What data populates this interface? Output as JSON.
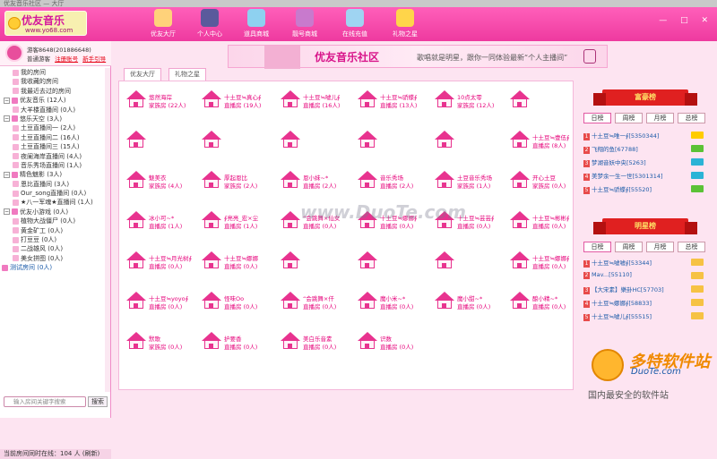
{
  "window": {
    "title": "优友音乐社区 — 大厅"
  },
  "logo": {
    "title": "优友音乐",
    "url": "www.yo68.com"
  },
  "nav": [
    {
      "label": "优友大厅",
      "icon": "house-icon"
    },
    {
      "label": "个人中心",
      "icon": "person-icon"
    },
    {
      "label": "道具商城",
      "icon": "shop-icon"
    },
    {
      "label": "靓号商城",
      "icon": "number-icon"
    },
    {
      "label": "在线充值",
      "icon": "coin-icon"
    },
    {
      "label": "礼物之星",
      "icon": "star-icon"
    }
  ],
  "user": {
    "name": "游客8648(201886648)",
    "role": "普通游客",
    "register": "注册账号",
    "newbie": "新手引导"
  },
  "tree": [
    {
      "type": "c",
      "label": "我的房间"
    },
    {
      "type": "c",
      "label": "我收藏的房间"
    },
    {
      "type": "c",
      "label": "我最近去过的房间"
    },
    {
      "type": "g",
      "label": "优友音乐  (12人)"
    },
    {
      "type": "c",
      "label": "大羊楼直播间  (0人)"
    },
    {
      "type": "g",
      "label": "悠乐天空  (3人)"
    },
    {
      "type": "c",
      "label": "土豆直播间一  (2人)"
    },
    {
      "type": "c",
      "label": "土豆直播间二  (16人)"
    },
    {
      "type": "c",
      "label": "土豆直播间三  (15人)"
    },
    {
      "type": "c",
      "label": "夜阑海岸直播间  (4人)"
    },
    {
      "type": "c",
      "label": "音乐秀场直播间  (1人)"
    },
    {
      "type": "g",
      "label": "精色魅影  (3人)"
    },
    {
      "type": "c",
      "label": "恩比直播间  (3人)"
    },
    {
      "type": "c",
      "label": "Our_song直播间  (0人)"
    },
    {
      "type": "c",
      "label": "★八一军魂★直播间  (1人)"
    },
    {
      "type": "g",
      "label": "优友小游戏  (0人)"
    },
    {
      "type": "c",
      "label": "植物大战僵尸  (0人)"
    },
    {
      "type": "c",
      "label": "黄金矿工  (0人)"
    },
    {
      "type": "c",
      "label": "打豆豆  (0人)"
    },
    {
      "type": "c",
      "label": "二战雄风  (0人)"
    },
    {
      "type": "c",
      "label": "美女拼图  (0人)"
    },
    {
      "type": "r",
      "label": "测试房间  (0人)"
    }
  ],
  "search": {
    "placeholder": "输入房间关键字搜索",
    "button": "搜索"
  },
  "status": {
    "text": "当前房间同时在线：104 人",
    "refresh": "(刷新)"
  },
  "banner": {
    "title": "优友音乐社区",
    "text": "歌唱就是明星，跟你一同体验最新“个人主播间”"
  },
  "tabs": [
    {
      "label": "优友大厅"
    },
    {
      "label": "礼物之星"
    }
  ],
  "rooms": [
    {
      "name": "悠然海岸",
      "count": "家族房 (22人)"
    },
    {
      "name": "十土豆≒真心∮",
      "count": "直播房 (19人)"
    },
    {
      "name": "十土豆≒嘘儿∮",
      "count": "直播房 (16人)"
    },
    {
      "name": "十土豆≒骄蝶∮",
      "count": "直播房 (13人)"
    },
    {
      "name": "10点太零",
      "count": "家族房 (12人)"
    },
    {
      "name": "",
      "count": ""
    },
    {
      "name": "",
      "count": ""
    },
    {
      "name": "",
      "count": ""
    },
    {
      "name": "",
      "count": ""
    },
    {
      "name": "",
      "count": ""
    },
    {
      "name": "",
      "count": ""
    },
    {
      "name": "十土豆≒壹伍∮",
      "count": "直播房 (8人)"
    },
    {
      "name": "魅美衣",
      "count": "家族房 (4人)"
    },
    {
      "name": "厚起恩比",
      "count": "家族房 (2人)"
    },
    {
      "name": "恩小妹~*",
      "count": "直播房 (2人)"
    },
    {
      "name": "音乐秀场",
      "count": "直播房 (2人)"
    },
    {
      "name": "土豆音乐秀场",
      "count": "家族房 (1人)"
    },
    {
      "name": "开心土豆",
      "count": "家族房 (0人)"
    },
    {
      "name": "冰小可~*",
      "count": "直播房 (1人)"
    },
    {
      "name": "∮亮亮_宏×尘",
      "count": "直播房 (1人)"
    },
    {
      "name": "“会跳舞×仙女",
      "count": "直播房 (0人)"
    },
    {
      "name": "十土豆≒娜娜∮",
      "count": "直播房 (0人)"
    },
    {
      "name": "十土豆≒芸芸∮",
      "count": "直播房 (0人)"
    },
    {
      "name": "十土豆≒彬彬∮",
      "count": "直播房 (0人)"
    },
    {
      "name": "十土豆≒月光树∮",
      "count": "直播房 (0人)"
    },
    {
      "name": "十土豆≒娜娜",
      "count": "直播房 (0人)"
    },
    {
      "name": "",
      "count": ""
    },
    {
      "name": "",
      "count": ""
    },
    {
      "name": "",
      "count": ""
    },
    {
      "name": "十土豆≒娜娜∮",
      "count": "直播房 (0人)"
    },
    {
      "name": "十土豆≒yoyo∮",
      "count": "直播房 (0人)"
    },
    {
      "name": "怪味Oo",
      "count": "直播房 (0人)"
    },
    {
      "name": "“会跳舞×仟",
      "count": "直播房 (0人)"
    },
    {
      "name": "魔小米~*",
      "count": "直播房 (0人)"
    },
    {
      "name": "魔小甜~*",
      "count": "直播房 (0人)"
    },
    {
      "name": "酿小精~*",
      "count": "直播房 (0人)"
    },
    {
      "name": "默歌",
      "count": "家族房 (0人)"
    },
    {
      "name": "护要香",
      "count": "直播房 (0人)"
    },
    {
      "name": "美白乐音素",
      "count": "直播房 (0人)"
    },
    {
      "name": "识数",
      "count": "直播房 (0人)"
    }
  ],
  "rank1": {
    "title": "富豪榜",
    "tabs": [
      "日榜",
      "周榜",
      "月榜",
      "总榜"
    ],
    "items": [
      {
        "n": "1",
        "text": "十土豆≒唯一∮[5350344]"
      },
      {
        "n": "2",
        "text": "飞翔的鱼[67788]"
      },
      {
        "n": "3",
        "text": "梦湖音妖中央[5263]"
      },
      {
        "n": "4",
        "text": "美梦余一生一世[5301314]"
      },
      {
        "n": "5",
        "text": "十土豆≒骄蝶∮[55520]"
      }
    ]
  },
  "rank2": {
    "title": "明星榜",
    "tabs": [
      "日榜",
      "周榜",
      "月榜",
      "总榜"
    ],
    "items": [
      {
        "n": "1",
        "text": "十土豆≒嘘嘘∮[53344]"
      },
      {
        "n": "2",
        "text": "Mav...[55110]"
      },
      {
        "n": "3",
        "text": "【大宋素】樂卦HC[57703]"
      },
      {
        "n": "4",
        "text": "十土豆≒娜娜∮[58833]"
      },
      {
        "n": "5",
        "text": "十土豆≒嘘儿∮[55515]"
      }
    ]
  },
  "watermark": "www.DuoTe.com",
  "brand": {
    "name": "多特软件站",
    "site": "DuoTe.com",
    "slogan": "国内最安全的软件站"
  },
  "colors": {
    "accent": "#ee3a9f",
    "roomText": "#e6007a",
    "ribbon": "#e02020"
  }
}
